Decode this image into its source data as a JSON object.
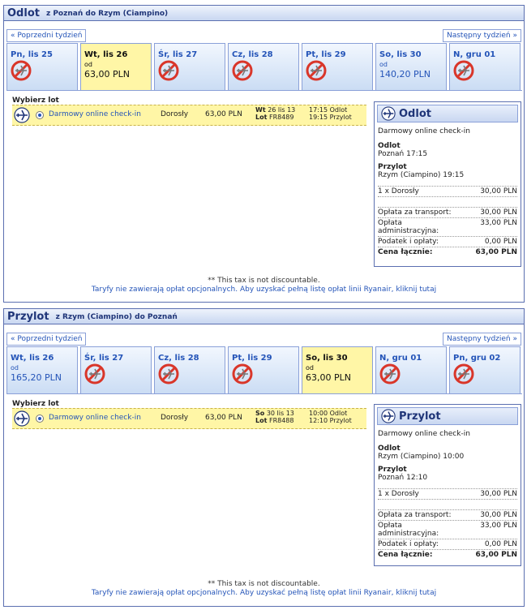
{
  "outbound": {
    "title": "Odlot",
    "route": "z Poznań do Rzym (Ciampino)",
    "prev_week": "« Poprzedni tydzień",
    "next_week": "Następny tydzień »",
    "days": [
      {
        "label": "Pn, lis 25",
        "od": "",
        "price": ""
      },
      {
        "label": "Wt, lis 26",
        "od": "od",
        "price": "63,00 PLN"
      },
      {
        "label": "Śr, lis 27",
        "od": "",
        "price": ""
      },
      {
        "label": "Cz, lis 28",
        "od": "",
        "price": ""
      },
      {
        "label": "Pt, lis 29",
        "od": "",
        "price": ""
      },
      {
        "label": "So, lis 30",
        "od": "od",
        "price": "140,20 PLN"
      },
      {
        "label": "N, gru 01",
        "od": "",
        "price": ""
      }
    ],
    "choose_label": "Wybierz lot",
    "flight": {
      "checkin": "Darmowy online check-in",
      "pax": "Dorosły",
      "price": "63,00 PLN",
      "day_bold": "Wt",
      "date": "26 lis 13",
      "lot_bold": "Lot",
      "flight_no": "FR8489",
      "dep_time": "17:15 Odlot",
      "arr_time": "19:15 Przylot"
    },
    "summary": {
      "title": "Odlot",
      "checkin": "Darmowy online check-in",
      "dep_label": "Odlot",
      "dep_value": "Poznań 17:15",
      "arr_label": "Przylot",
      "arr_value": "Rzym (Ciampino) 19:15",
      "pax_label": "1 x Dorosły",
      "pax_value": "30,00 PLN",
      "transport_label": "Opłata za transport:",
      "transport_value": "30,00 PLN",
      "admin_label": "Opłata administracyjna:",
      "admin_value": "33,00 PLN",
      "tax_label": "Podatek i opłaty:",
      "tax_value": "0,00 PLN",
      "total_label": "Cena łącznie:",
      "total_value": "63,00 PLN"
    },
    "tax_note": "** This tax is not discountable.",
    "fares_note": "Taryfy nie zawierają opłat opcjonalnych. Aby uzyskać pełną listę opłat linii Ryanair, kliknij tutaj"
  },
  "inbound": {
    "title": "Przylot",
    "route": "z Rzym (Ciampino) do Poznań",
    "prev_week": "« Poprzedni tydzień",
    "next_week": "Następny tydzień »",
    "days": [
      {
        "label": "Wt, lis 26",
        "od": "od",
        "price": "165,20 PLN"
      },
      {
        "label": "Śr, lis 27",
        "od": "",
        "price": ""
      },
      {
        "label": "Cz, lis 28",
        "od": "",
        "price": ""
      },
      {
        "label": "Pt, lis 29",
        "od": "",
        "price": ""
      },
      {
        "label": "So, lis 30",
        "od": "od",
        "price": "63,00 PLN"
      },
      {
        "label": "N, gru 01",
        "od": "",
        "price": ""
      },
      {
        "label": "Pn, gru 02",
        "od": "",
        "price": ""
      }
    ],
    "choose_label": "Wybierz lot",
    "flight": {
      "checkin": "Darmowy online check-in",
      "pax": "Dorosły",
      "price": "63,00 PLN",
      "day_bold": "So",
      "date": "30 lis 13",
      "lot_bold": "Lot",
      "flight_no": "FR8488",
      "dep_time": "10:00 Odlot",
      "arr_time": "12:10 Przylot"
    },
    "summary": {
      "title": "Przylot",
      "checkin": "Darmowy online check-in",
      "dep_label": "Odlot",
      "dep_value": "Rzym (Ciampino) 10:00",
      "arr_label": "Przylot",
      "arr_value": "Poznań 12:10",
      "pax_label": "1 x Dorosły",
      "pax_value": "30,00 PLN",
      "transport_label": "Opłata za transport:",
      "transport_value": "30,00 PLN",
      "admin_label": "Opłata administracyjna:",
      "admin_value": "33,00 PLN",
      "tax_label": "Podatek i opłaty:",
      "tax_value": "0,00 PLN",
      "total_label": "Cena łącznie:",
      "total_value": "63,00 PLN"
    },
    "tax_note": "** This tax is not discountable.",
    "fares_note": "Taryfy nie zawierają opłat opcjonalnych. Aby uzyskać pełną listę opłat linii Ryanair, kliknij tutaj"
  }
}
